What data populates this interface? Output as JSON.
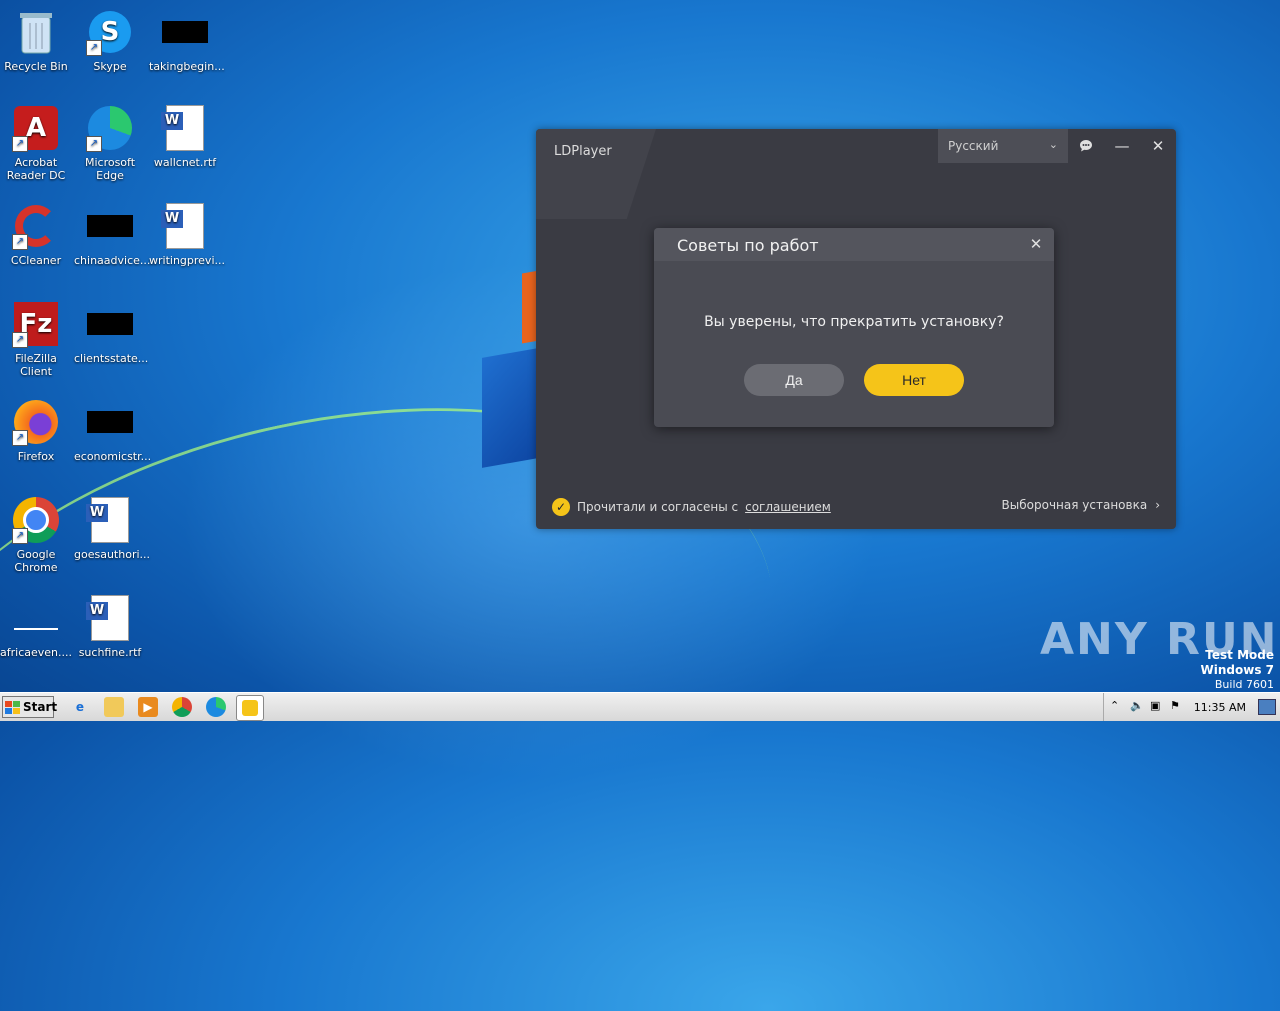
{
  "desktop": {
    "icons": [
      {
        "label": "Recycle Bin"
      },
      {
        "label": "Skype"
      },
      {
        "label": "takingbegin..."
      },
      {
        "label": "Acrobat Reader DC"
      },
      {
        "label": "Microsoft Edge"
      },
      {
        "label": "wallcnet.rtf"
      },
      {
        "label": "CCleaner"
      },
      {
        "label": "chinaadvice..."
      },
      {
        "label": "writingprevi..."
      },
      {
        "label": "FileZilla Client"
      },
      {
        "label": "clientsstate..."
      },
      {
        "label": "Firefox"
      },
      {
        "label": "economicstr..."
      },
      {
        "label": "Google Chrome"
      },
      {
        "label": "goesauthori..."
      },
      {
        "label": "africaeven...."
      },
      {
        "label": "suchfine.rtf"
      }
    ]
  },
  "ldplayer": {
    "title": "LDPlayer",
    "language": "Русский",
    "agreement_prefix": "Прочитали и согласены с",
    "agreement_link": "соглашением",
    "custom_install": "Выборочная установка"
  },
  "dialog": {
    "title": "Советы по работ",
    "message": "Вы уверены, что прекратить установку?",
    "yes_label": "Да",
    "no_label": "Нет"
  },
  "taskbar": {
    "start_label": "Start",
    "clock": "11:35 AM"
  },
  "watermark": "ANY RUN",
  "test_mode": {
    "line1": "Test Mode",
    "line2": "Windows 7",
    "line3": "Build 7601"
  },
  "colors": {
    "accent_yellow": "#f5c419",
    "window_bg": "#3a3b43",
    "dialog_bg": "#4a4b53"
  }
}
